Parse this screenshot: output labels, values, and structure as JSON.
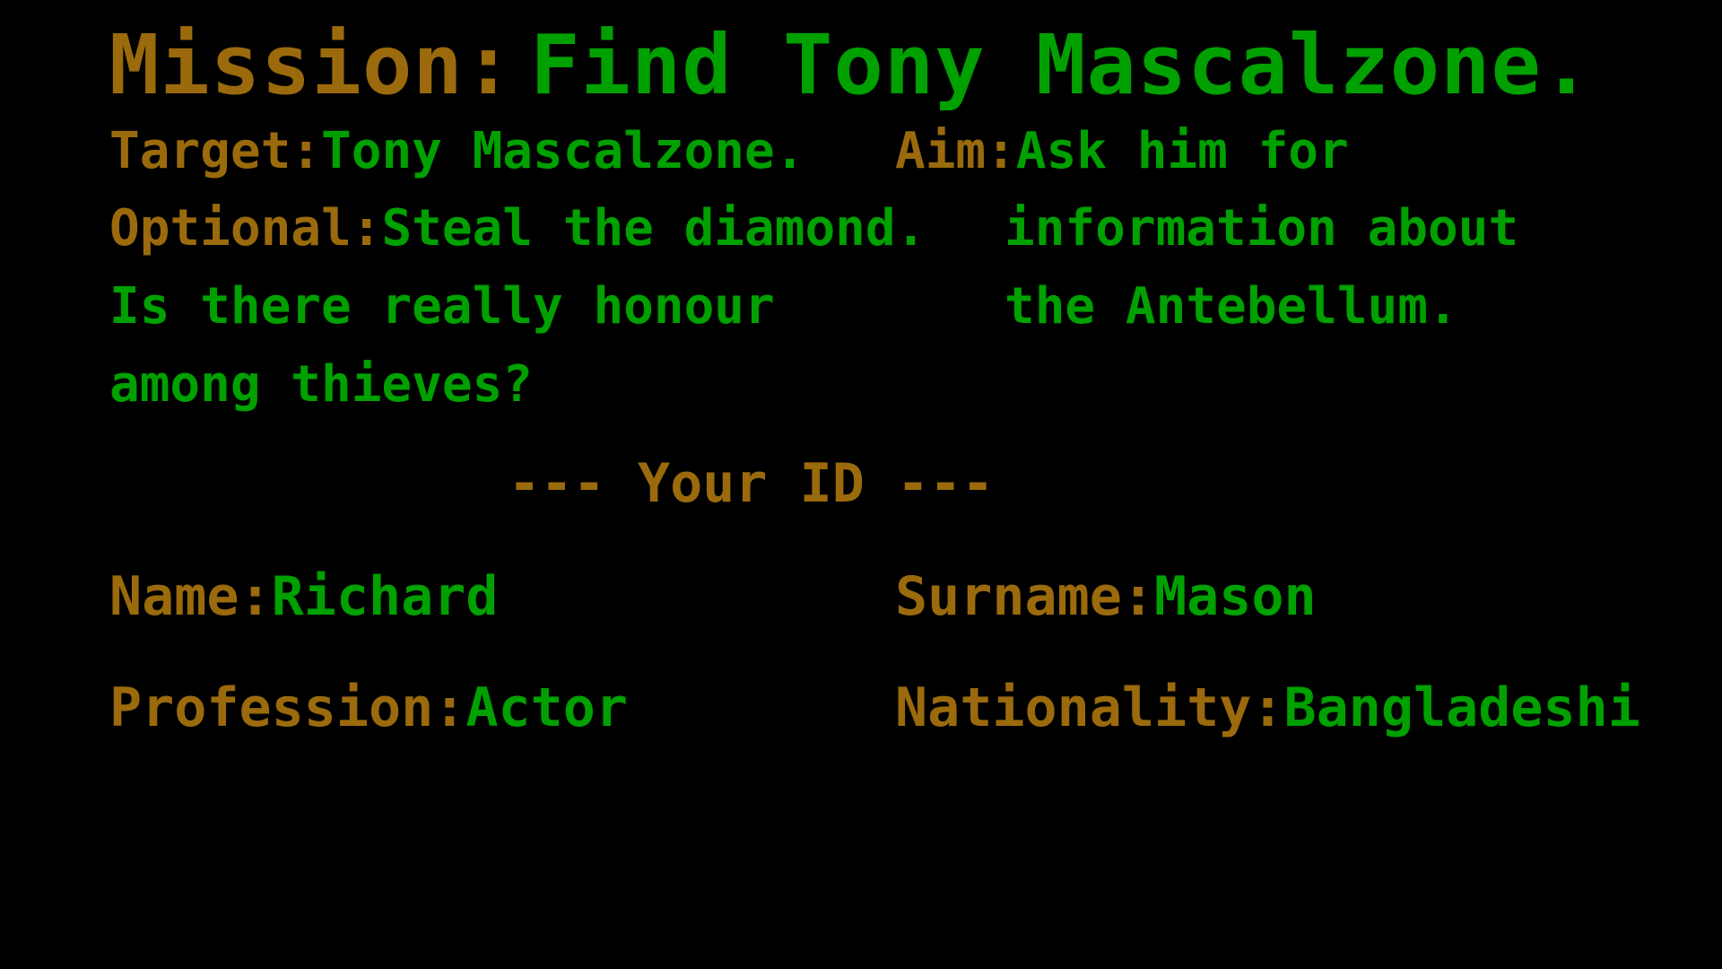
{
  "mission": {
    "label": "Mission:",
    "value": "Find Tony Mascalzone."
  },
  "briefing": {
    "target_label": "Target:",
    "target_value": "Tony Mascalzone.",
    "optional_label": "Optional:",
    "optional_value": "Steal the diamond.",
    "flavor_line_1": "Is there really honour",
    "flavor_line_2": "among thieves?",
    "aim_label": "Aim:",
    "aim_line_1": "Ask him for",
    "aim_line_2": "information about",
    "aim_line_3": "the Antebellum."
  },
  "id_card": {
    "header": "--- Your ID ---",
    "name_label": "Name:",
    "name_value": "Richard",
    "surname_label": "Surname:",
    "surname_value": "Mason",
    "profession_label": "Profession:",
    "profession_value": "Actor",
    "nationality_label": "Nationality:",
    "nationality_value": "Bangladeshi"
  },
  "colors": {
    "background": "#000000",
    "label": "#9a6a0c",
    "value": "#00a000"
  }
}
